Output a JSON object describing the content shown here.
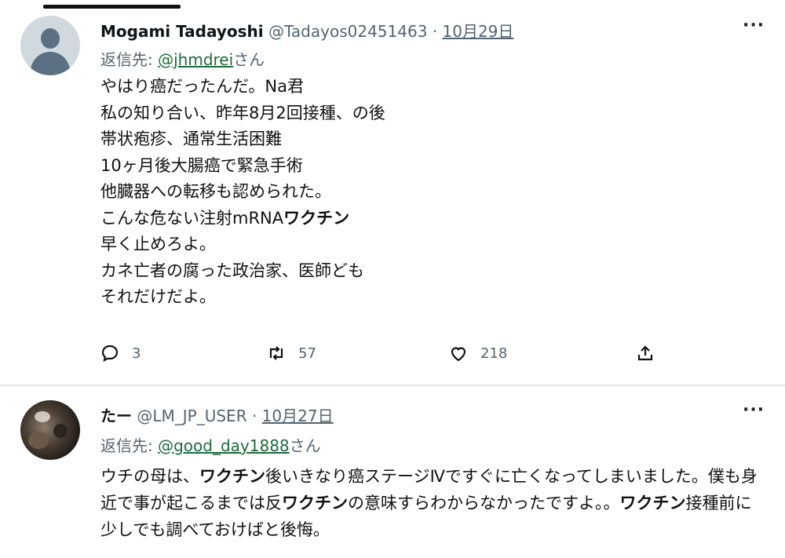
{
  "tweets": [
    {
      "author_name": "Mogami Tadayoshi",
      "handle": "@Tadayos02451463",
      "separator": "·",
      "date": "10月29日",
      "more": "···",
      "reply_prefix": "返信先: ",
      "reply_mention": "@jhmdrei",
      "reply_suffix": "さん",
      "lines": [
        [
          {
            "t": "やはり癌だったんだ。Na君",
            "b": false
          }
        ],
        [
          {
            "t": "私の知り合い、昨年8月2回接種、の後",
            "b": false
          }
        ],
        [
          {
            "t": "帯状疱疹、通常生活困難",
            "b": false
          }
        ],
        [
          {
            "t": "10ヶ月後大腸癌で緊急手術",
            "b": false
          }
        ],
        [
          {
            "t": "他臓器への転移も認められた。",
            "b": false
          }
        ],
        [
          {
            "t": "こんな危ない注射mRNA",
            "b": false
          },
          {
            "t": "ワクチン",
            "b": true
          }
        ],
        [
          {
            "t": "早く止めろよ。",
            "b": false
          }
        ],
        [
          {
            "t": "カネ亡者の腐った政治家、医師ども",
            "b": false
          }
        ],
        [
          {
            "t": "それだけだよ。",
            "b": false
          }
        ]
      ],
      "replies": "3",
      "retweets": "57",
      "likes": "218"
    },
    {
      "author_name": "たー",
      "handle": "@LM_JP_USER",
      "separator": "·",
      "date": "10月27日",
      "more": "···",
      "reply_prefix": "返信先: ",
      "reply_mention": "@good_day1888",
      "reply_suffix": "さん",
      "segments": [
        {
          "t": "ウチの母は、",
          "b": false
        },
        {
          "t": "ワクチン",
          "b": true
        },
        {
          "t": "後いきなり癌ステージⅣですぐに亡くなってしまいました。僕も身近で事が起こるまでは反",
          "b": false
        },
        {
          "t": "ワクチン",
          "b": true
        },
        {
          "t": "の意味すらわからなかったですよ。。",
          "b": false
        },
        {
          "t": "ワクチン",
          "b": true
        },
        {
          "t": "接種前に少しでも調べておけばと後悔。",
          "b": false
        }
      ]
    }
  ],
  "icons": {
    "reply": "reply-icon",
    "retweet": "retweet-icon",
    "like": "heart-icon",
    "share": "share-icon",
    "more": "more-icon"
  },
  "colors": {
    "secondary_text": "#536471",
    "mention": "#1d6b3a",
    "divider": "#e7e9ea"
  }
}
